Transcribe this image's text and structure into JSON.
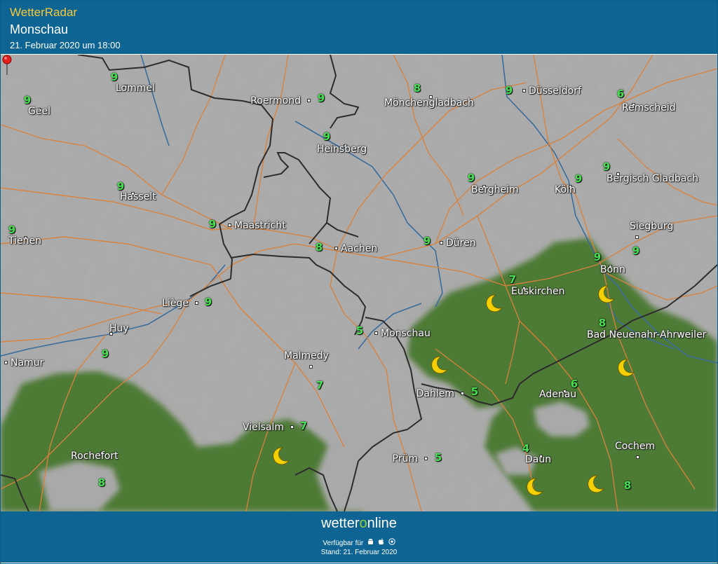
{
  "header": {
    "app_title": "WetterRadar",
    "place": "Monschau",
    "datetime": "21. Februar 2020 um 18:00"
  },
  "map": {
    "cities": [
      {
        "name": "Lommel"
      },
      {
        "name": "Geel"
      },
      {
        "name": "Roermond"
      },
      {
        "name": "Mönchengladbach"
      },
      {
        "name": "Düsseldorf"
      },
      {
        "name": "Remscheid"
      },
      {
        "name": "Heinsberg"
      },
      {
        "name": "Hasselt"
      },
      {
        "name": "Bergheim"
      },
      {
        "name": "Köln"
      },
      {
        "name": "Bergisch Gladbach"
      },
      {
        "name": "Maastricht"
      },
      {
        "name": "Tienen"
      },
      {
        "name": "Aachen"
      },
      {
        "name": "Düren"
      },
      {
        "name": "Siegburg"
      },
      {
        "name": "Bonn"
      },
      {
        "name": "Euskirchen"
      },
      {
        "name": "Liège"
      },
      {
        "name": "Huy"
      },
      {
        "name": "Monschau"
      },
      {
        "name": "Bad Neuenahr-Ahrweiler"
      },
      {
        "name": "Namur"
      },
      {
        "name": "Malmedy"
      },
      {
        "name": "Dahlem"
      },
      {
        "name": "Adenau"
      },
      {
        "name": "Vielsalm"
      },
      {
        "name": "Rochefort"
      },
      {
        "name": "Prüm"
      },
      {
        "name": "Daun"
      },
      {
        "name": "Cochem"
      }
    ],
    "temperatures": [
      "9",
      "9",
      "9",
      "8",
      "9",
      "6",
      "9",
      "9",
      "9",
      "9",
      "9",
      "9",
      "9",
      "8",
      "9",
      "9",
      "9",
      "7",
      "9",
      "9",
      "5",
      "8",
      "7",
      "5",
      "6",
      "7",
      "8",
      "5",
      "4",
      "8"
    ],
    "night_icon": "moon-icon",
    "location_marker": "map-pin-icon"
  },
  "footer": {
    "brand_prefix": "wetter",
    "brand_o": "o",
    "brand_suffix": "nline",
    "availability": "Verfügbar für",
    "platform_icons": [
      "android-icon",
      "apple-icon",
      "web-icon"
    ],
    "stand": "Stand: 21. Februar 2020"
  },
  "colors": {
    "header_bg": "#0e6594",
    "title_yellow": "#f6c83b",
    "map_gray": "#a7a7a7",
    "precip_green": "#4e7a35",
    "roads": "#d9823d",
    "rivers": "#3b6c9a",
    "borders": "#2b2b2b",
    "temp_green": "#44e04f"
  }
}
